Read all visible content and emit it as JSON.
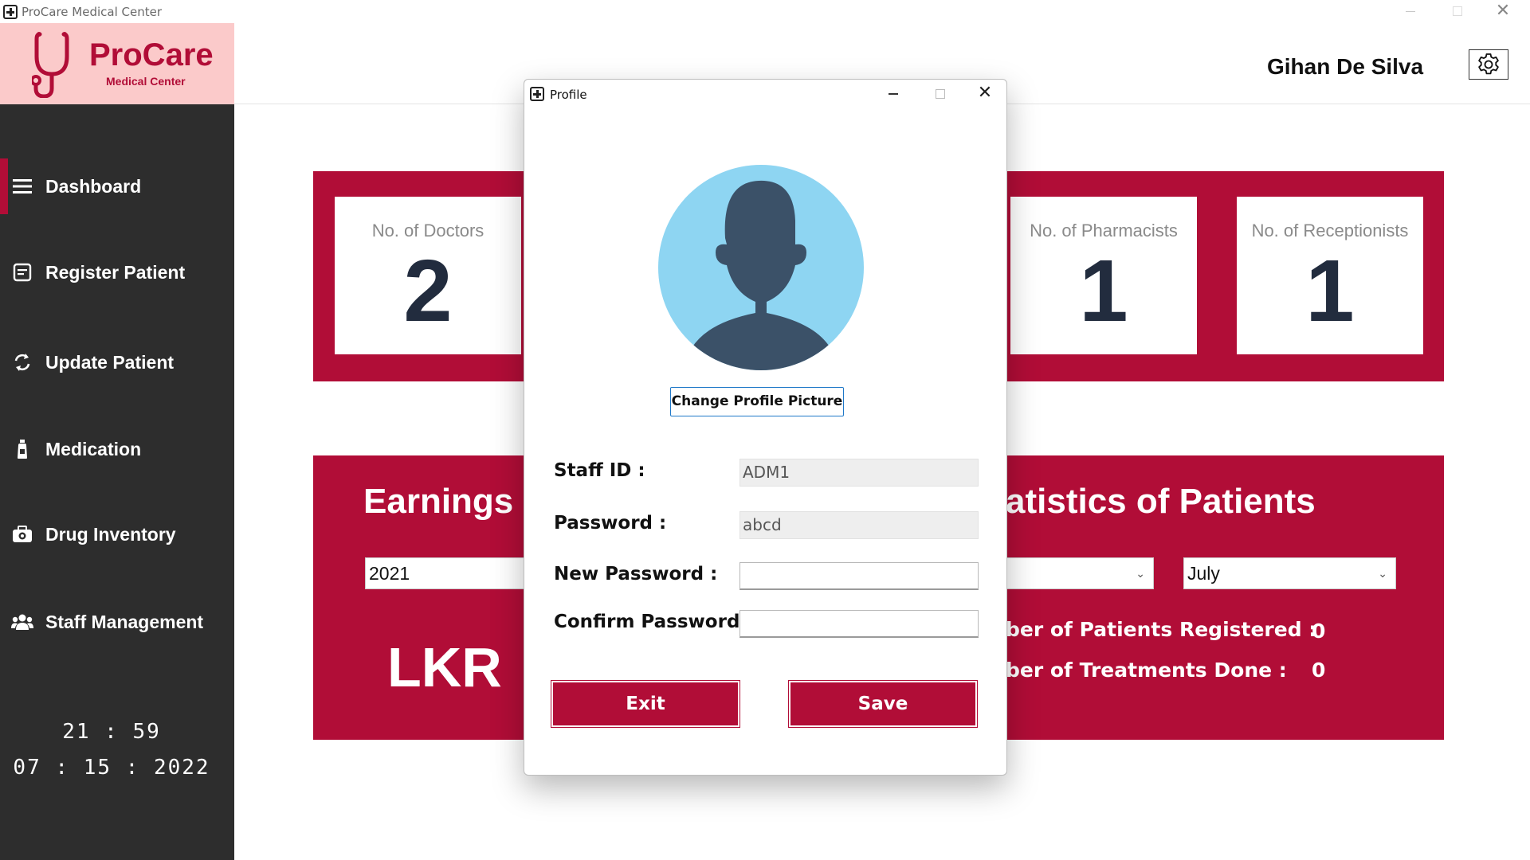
{
  "window": {
    "title": "ProCare Medical Center"
  },
  "brand": {
    "name": "ProCare",
    "subtitle": "Medical Center",
    "color": "#b10d37"
  },
  "header": {
    "user_name": "Gihan De Silva",
    "settings_icon": "gear-icon"
  },
  "sidebar": {
    "items": [
      {
        "label": "Dashboard",
        "icon": "menu-icon",
        "active": true
      },
      {
        "label": "Register Patient",
        "icon": "form-icon"
      },
      {
        "label": "Update Patient",
        "icon": "refresh-icon"
      },
      {
        "label": "Medication",
        "icon": "medicine-bottle-icon"
      },
      {
        "label": "Drug Inventory",
        "icon": "medkit-icon"
      },
      {
        "label": "Staff Management",
        "icon": "users-icon"
      }
    ],
    "time": "21 : 59",
    "date": "07 : 15 : 2022"
  },
  "dashboard": {
    "cards": [
      {
        "label": "No. of Doctors",
        "value": "2"
      },
      {
        "label": "No. of Pharmacists",
        "value": "1"
      },
      {
        "label": "No. of Receptionists",
        "value": "1"
      }
    ],
    "earnings": {
      "title": "Earnings",
      "year": "2021",
      "currency": "LKR"
    },
    "statistics": {
      "title_visible": "atistics of Patients",
      "month": "July",
      "registered_label": "ber of Patients Registered :",
      "registered_value": "0",
      "treatments_label": "ber of Treatments Done :",
      "treatments_value": "0"
    }
  },
  "dialog": {
    "title": "Profile",
    "change_picture_label": "Change Profile Picture",
    "staff_id_label": "Staff ID :",
    "staff_id_value": "ADM1",
    "password_label": "Password :",
    "password_value": "abcd",
    "new_password_label": "New Password :",
    "new_password_value": "",
    "confirm_password_label": "Confirm Password :",
    "confirm_password_value": "",
    "exit_label": "Exit",
    "save_label": "Save"
  }
}
